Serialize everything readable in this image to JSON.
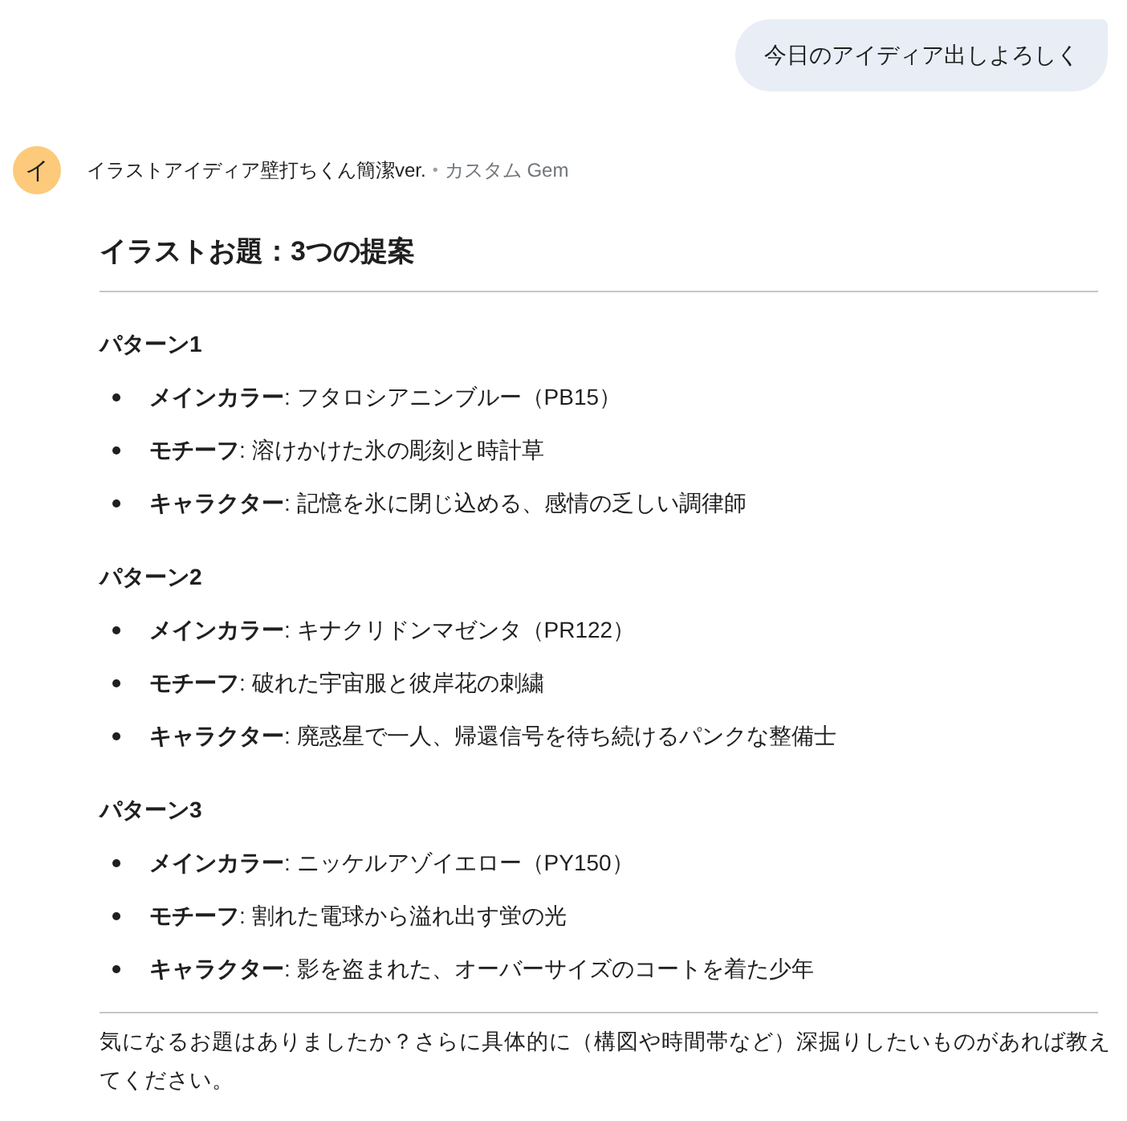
{
  "user_message": "今日のアイディア出しよろしく",
  "assistant": {
    "avatar_letter": "イ",
    "name": "イラストアイディア壁打ちくん簡潔ver.",
    "separator": "•",
    "tag": "カスタム Gem"
  },
  "heading": "イラストお題：3つの提案",
  "patterns": [
    {
      "title": "パターン1",
      "items": [
        "**メインカラー**: フタロシアニンブルー（PB15）",
        "**モチーフ**: 溶けかけた氷の彫刻と時計草",
        "**キャラクター**: 記憶を氷に閉じ込める、感情の乏しい調律師"
      ]
    },
    {
      "title": "パターン2",
      "items": [
        "**メインカラー**: キナクリドンマゼンタ（PR122）",
        "**モチーフ**: 破れた宇宙服と彼岸花の刺繍",
        "**キャラクター**: 廃惑星で一人、帰還信号を待ち続けるパンクな整備士"
      ]
    },
    {
      "title": "パターン3",
      "items": [
        "**メインカラー**: ニッケルアゾイエロー（PY150）",
        "**モチーフ**: 割れた電球から溢れ出す蛍の光",
        "**キャラクター**: 影を盗まれた、オーバーサイズのコートを着た少年"
      ]
    }
  ],
  "closing": "気になるお題はありましたか？さらに具体的に（構図や時間帯など）深掘りしたいものがあれば教えてください。"
}
